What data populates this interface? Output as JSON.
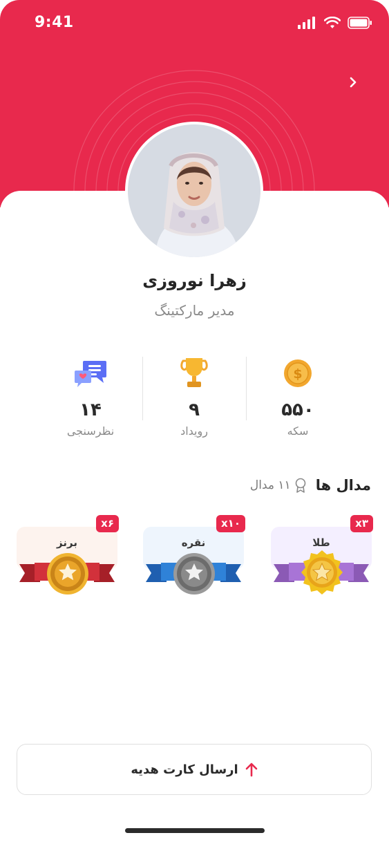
{
  "status_bar": {
    "time": "9:41"
  },
  "profile": {
    "name": "زهرا نوروزی",
    "role": "مدیر مارکتینگ"
  },
  "stats": [
    {
      "value": "۵۵۰",
      "label": "سکه",
      "icon": "coin-icon"
    },
    {
      "value": "۹",
      "label": "رویداد",
      "icon": "trophy-icon"
    },
    {
      "value": "۱۴",
      "label": "نظرسنجی",
      "icon": "chat-icon"
    }
  ],
  "medals": {
    "title": "مدال ها",
    "count": "۱۱ مدال",
    "items": [
      {
        "label": "طلا",
        "badge": "x۳",
        "tier": "gold"
      },
      {
        "label": "نقره",
        "badge": "x۱۰",
        "tier": "silver"
      },
      {
        "label": "برنز",
        "badge": "x۶",
        "tier": "bronze"
      }
    ]
  },
  "gift_button": {
    "label": "ارسال کارت هدیه"
  },
  "colors": {
    "brand": "#e8294d",
    "gold": "#f2b21c",
    "silver": "#7d7d7d",
    "bronze": "#e8a629"
  }
}
